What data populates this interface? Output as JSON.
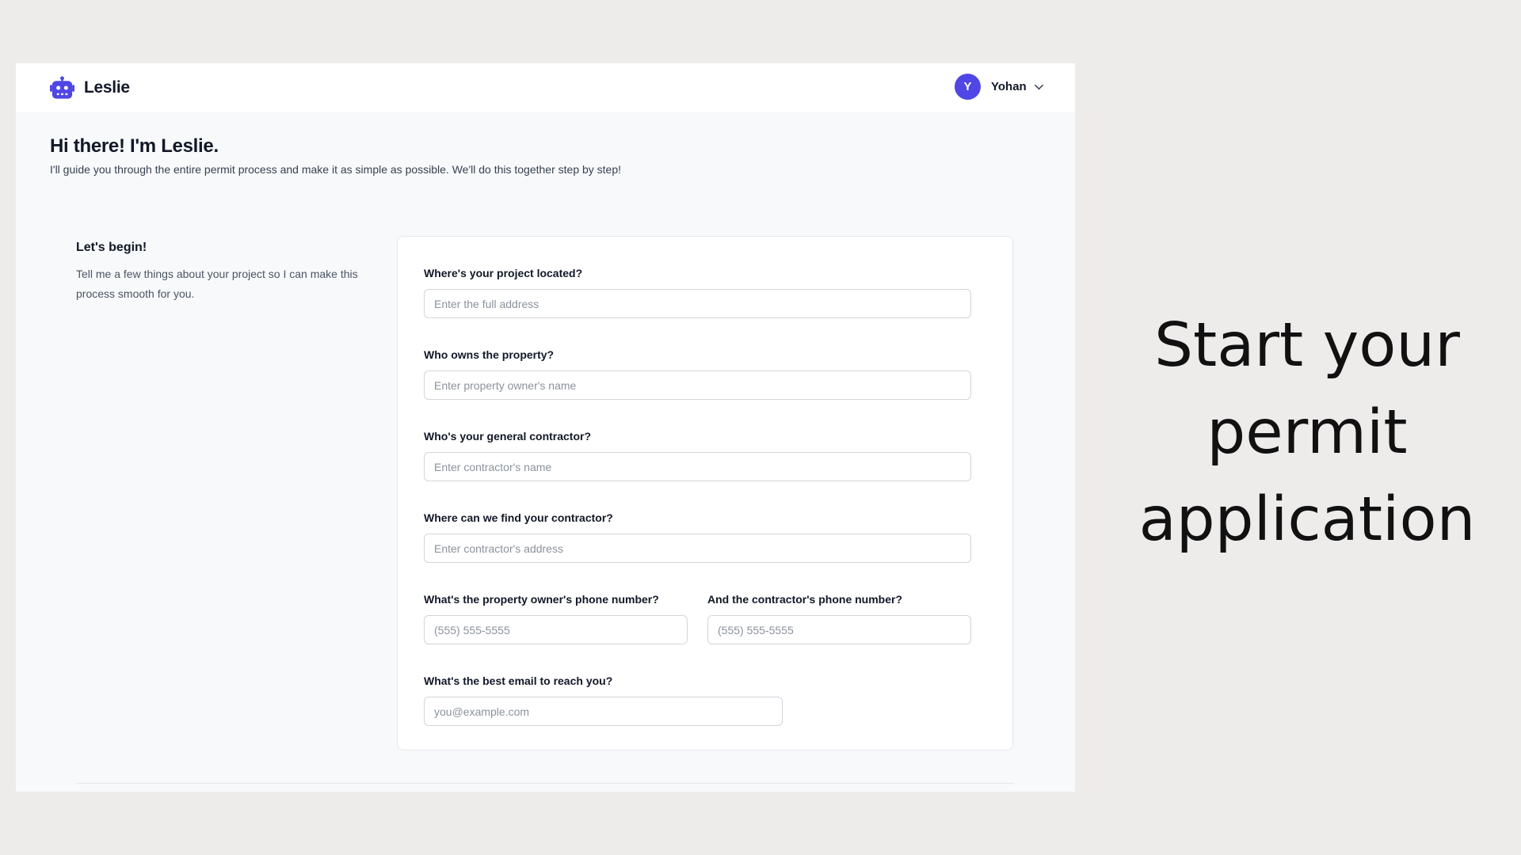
{
  "app": {
    "name": "Leslie"
  },
  "user": {
    "initial": "Y",
    "name": "Yohan"
  },
  "hero": {
    "title": "Hi there! I'm Leslie.",
    "subtitle": "I'll guide you through the entire permit process and make it as simple as possible. We'll do this together step by step!"
  },
  "sidebar": {
    "title": "Let's begin!",
    "description": "Tell me a few things about your project so I can make this process smooth for you."
  },
  "form": {
    "fields": [
      {
        "label": "Where's your project located?",
        "placeholder": "Enter the full address",
        "value": ""
      },
      {
        "label": "Who owns the property?",
        "placeholder": "Enter property owner's name",
        "value": ""
      },
      {
        "label": "Who's your general contractor?",
        "placeholder": "Enter contractor's name",
        "value": ""
      },
      {
        "label": "Where can we find your contractor?",
        "placeholder": "Enter contractor's address",
        "value": ""
      },
      {
        "label": "What's the property owner's phone number?",
        "placeholder": "(555) 555-5555",
        "value": ""
      },
      {
        "label": "And the contractor's phone number?",
        "placeholder": "(555) 555-5555",
        "value": ""
      },
      {
        "label": "What's the best email to reach you?",
        "placeholder": "you@example.com",
        "value": ""
      }
    ]
  },
  "tagline": "Start your permit application",
  "icons": {
    "logo": "robot-icon",
    "user_menu": "chevron-down-icon"
  },
  "colors": {
    "accent": "#4f46e5",
    "background": "#eeebeb",
    "window": "#f8f9fb"
  }
}
